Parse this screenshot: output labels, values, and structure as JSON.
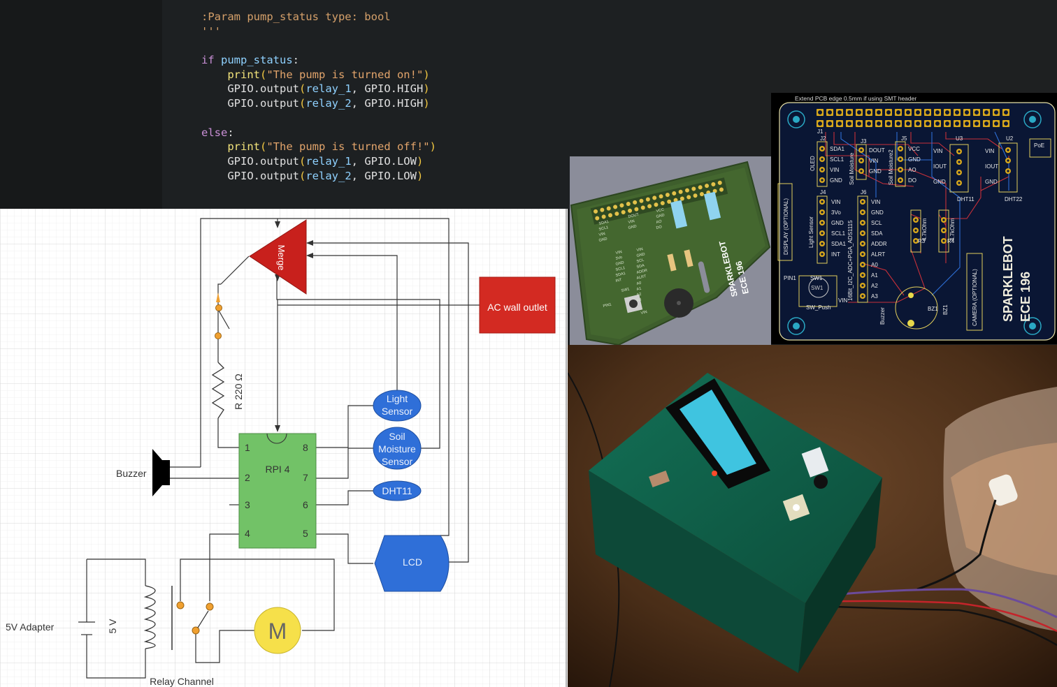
{
  "code": {
    "lines": [
      {
        "parts": [
          {
            "t": ":Param pump_status type: bool",
            "c": "c-doc"
          }
        ]
      },
      {
        "parts": [
          {
            "t": "'''",
            "c": "c-doc"
          }
        ]
      },
      {
        "parts": [
          {
            "t": "",
            "c": "c-plain"
          }
        ]
      },
      {
        "parts": [
          {
            "t": "if ",
            "c": "c-kw"
          },
          {
            "t": "pump_status",
            "c": "c-var"
          },
          {
            "t": ":",
            "c": "c-plain"
          }
        ]
      },
      {
        "parts": [
          {
            "t": "    print",
            "c": "c-fn"
          },
          {
            "t": "(",
            "c": "c-par"
          },
          {
            "t": "\"The pump is turned on!\"",
            "c": "c-str"
          },
          {
            "t": ")",
            "c": "c-par"
          }
        ]
      },
      {
        "parts": [
          {
            "t": "    GPIO.output",
            "c": "c-plain"
          },
          {
            "t": "(",
            "c": "c-par"
          },
          {
            "t": "relay_1",
            "c": "c-var"
          },
          {
            "t": ", GPIO.HIGH",
            "c": "c-plain"
          },
          {
            "t": ")",
            "c": "c-par"
          }
        ]
      },
      {
        "parts": [
          {
            "t": "    GPIO.output",
            "c": "c-plain"
          },
          {
            "t": "(",
            "c": "c-par"
          },
          {
            "t": "relay_2",
            "c": "c-var"
          },
          {
            "t": ", GPIO.HIGH",
            "c": "c-plain"
          },
          {
            "t": ")",
            "c": "c-par"
          }
        ]
      },
      {
        "parts": [
          {
            "t": "",
            "c": "c-plain"
          }
        ]
      },
      {
        "parts": [
          {
            "t": "else",
            "c": "c-kw"
          },
          {
            "t": ":",
            "c": "c-plain"
          }
        ]
      },
      {
        "parts": [
          {
            "t": "    print",
            "c": "c-fn"
          },
          {
            "t": "(",
            "c": "c-par"
          },
          {
            "t": "\"The pump is turned off!\"",
            "c": "c-str"
          },
          {
            "t": ")",
            "c": "c-par"
          }
        ]
      },
      {
        "parts": [
          {
            "t": "    GPIO.output",
            "c": "c-plain"
          },
          {
            "t": "(",
            "c": "c-par"
          },
          {
            "t": "relay_1",
            "c": "c-var"
          },
          {
            "t": ", GPIO.LOW",
            "c": "c-plain"
          },
          {
            "t": ")",
            "c": "c-par"
          }
        ]
      },
      {
        "parts": [
          {
            "t": "    GPIO.output",
            "c": "c-plain"
          },
          {
            "t": "(",
            "c": "c-par"
          },
          {
            "t": "relay_2",
            "c": "c-var"
          },
          {
            "t": ", GPIO.LOW",
            "c": "c-plain"
          },
          {
            "t": ")",
            "c": "c-par"
          }
        ]
      }
    ]
  },
  "schematic": {
    "merge": "Merge",
    "ac_outlet": "AC wall outlet",
    "resistor": "R 220 Ω",
    "buzzer": "Buzzer",
    "chip": "RPI 4",
    "pins": {
      "p1": "1",
      "p2": "2",
      "p3": "3",
      "p4": "4",
      "p5": "5",
      "p6": "6",
      "p7": "7",
      "p8": "8"
    },
    "light_sensor": [
      "Light",
      "Sensor"
    ],
    "soil_sensor": [
      "Soil",
      "Moisture",
      "Sensor"
    ],
    "dht11": "DHT11",
    "lcd": "LCD",
    "adapter": "5V Adapter",
    "voltage": "5 V",
    "relay": "Relay Channel",
    "motor": "M"
  },
  "pcb_render": {
    "labels": [
      "SDA1",
      "SCL1",
      "VIN",
      "GND",
      "DOUT",
      "VIN",
      "GND",
      "VCC",
      "GND",
      "AO",
      "DO",
      "VIN",
      "3Vo",
      "GND",
      "SCL1",
      "SDA1",
      "INT",
      "VIN",
      "GND",
      "SCL",
      "SDA",
      "ADDR",
      "ALRT",
      "A0",
      "A1",
      "A2",
      "A3",
      "SW1",
      "PIN1",
      "VIN"
    ],
    "title": [
      "SPARKLEBOT",
      "ECE 196"
    ]
  },
  "pcb_layout": {
    "note": "Extend PCB edge 0.5mm if using SMT header",
    "refs": {
      "j1": "J1",
      "j2": "J2",
      "j3": "J3",
      "j5": "J5",
      "u3": "U3",
      "u2": "U2",
      "j4": "J4",
      "j6": "J6",
      "r3": "R3",
      "r4": "R4",
      "sw1": "SW1",
      "bz1": "BZ1",
      "bz1b": "BZ1"
    },
    "j2_pins": [
      "SDA1",
      "SCL1",
      "VIN",
      "GND"
    ],
    "j3_pins": [
      "DOUT",
      "VIN",
      "GND"
    ],
    "j5_pins": [
      "VCC",
      "GND",
      "AO",
      "DO"
    ],
    "u3_pins": [
      "VIN",
      "IOUT",
      "GND"
    ],
    "u2_pins": [
      "VIN",
      "IOUT",
      "GND"
    ],
    "j4_pins": [
      "VIN",
      "3Vo",
      "GND",
      "SCL1",
      "SDA1",
      "INT"
    ],
    "j6_pins": [
      "VIN",
      "GND",
      "SCL",
      "SDA",
      "ADDR",
      "ALRT",
      "A0",
      "A1",
      "A2",
      "A3"
    ],
    "oled": "OLED",
    "soil1": "Soil Moisture",
    "soil2": "Soil Moisture2",
    "dht11": "DHT11",
    "dht22": "DHT22",
    "poe": "PoE",
    "display": "DISPLAY (OPTIONAL)",
    "light": "Light Sensor",
    "adc": "16Bit_I2C_ADC+PGA_ADS1115",
    "r_val": "4.7kOhm",
    "r_val2": "4.7kOhm",
    "camera": "CAMERA (OPTIONAL)",
    "buzzer": "Buzzer",
    "sw_push": "SW_Push",
    "sw_label": "SW1",
    "pin1": "PIN1",
    "vin": "VIN",
    "title": [
      "SPARKLEBOT",
      "ECE 196"
    ]
  },
  "photo": {
    "lcd_color": "#3fc4e0",
    "box_color": "#0f5a43"
  }
}
